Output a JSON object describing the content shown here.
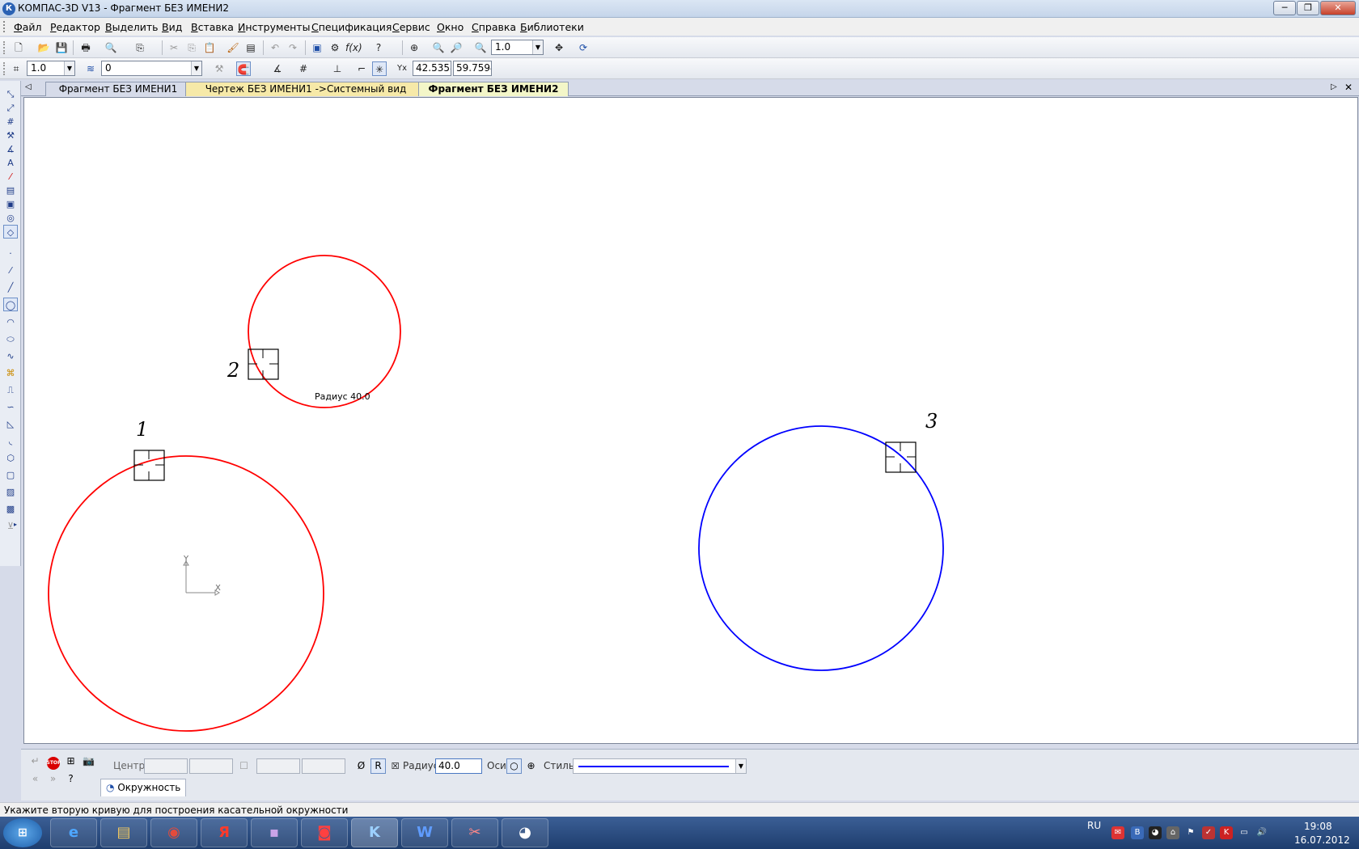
{
  "window": {
    "title": "КОМПАС-3D V13 - Фрагмент БЕЗ ИМЕНИ2",
    "app_icon": "К",
    "minimize": "─",
    "maximize": "❐",
    "close": "✕"
  },
  "menu": [
    "Файл",
    "Редактор",
    "Выделить",
    "Вид",
    "Вставка",
    "Инструменты",
    "Спецификация",
    "Сервис",
    "Окно",
    "Справка",
    "Библиотеки"
  ],
  "toolbar1": {
    "zoom_value": "1.0"
  },
  "toolbar2": {
    "scale_value": "1.0",
    "layer_value": "0",
    "coord_x": "42.5358",
    "coord_y": "59.7594"
  },
  "tabs": [
    {
      "label": "Фрагмент БЕЗ ИМЕНИ1",
      "color": "#d6dbe9"
    },
    {
      "label": "Чертеж БЕЗ ИМЕНИ1 ->Системный вид",
      "color": "#f6e9a8"
    },
    {
      "label": "Фрагмент БЕЗ ИМЕНИ2",
      "color": "#f3f6c8"
    }
  ],
  "drawing": {
    "labels": {
      "one": "1",
      "two": "2",
      "three": "3"
    },
    "radius_hint": "Радиус 40.0",
    "axis_x": "X",
    "axis_y": "Y",
    "colors": {
      "red_circle": "#ff0000",
      "blue_circle": "#0000ff"
    }
  },
  "propbar": {
    "center_label": "Центр",
    "diameter_btn": "Ø",
    "radius_btn": "R",
    "radius_label": "Радиус",
    "radius_value": "40.0",
    "axes_label": "Оси",
    "style_label": "Стиль",
    "tab_label": "Окружность",
    "stop_label": "STOP"
  },
  "status": {
    "message": "Укажите вторую кривую для построения касательной окружности"
  },
  "taskbar": {
    "start": "⊞",
    "apps": [
      "e",
      "▤",
      "◉",
      "Я",
      "▪",
      "◙",
      "K",
      "W",
      "✂",
      "◕"
    ],
    "language": "RU",
    "time": "19:08",
    "date": "16.07.2012"
  }
}
